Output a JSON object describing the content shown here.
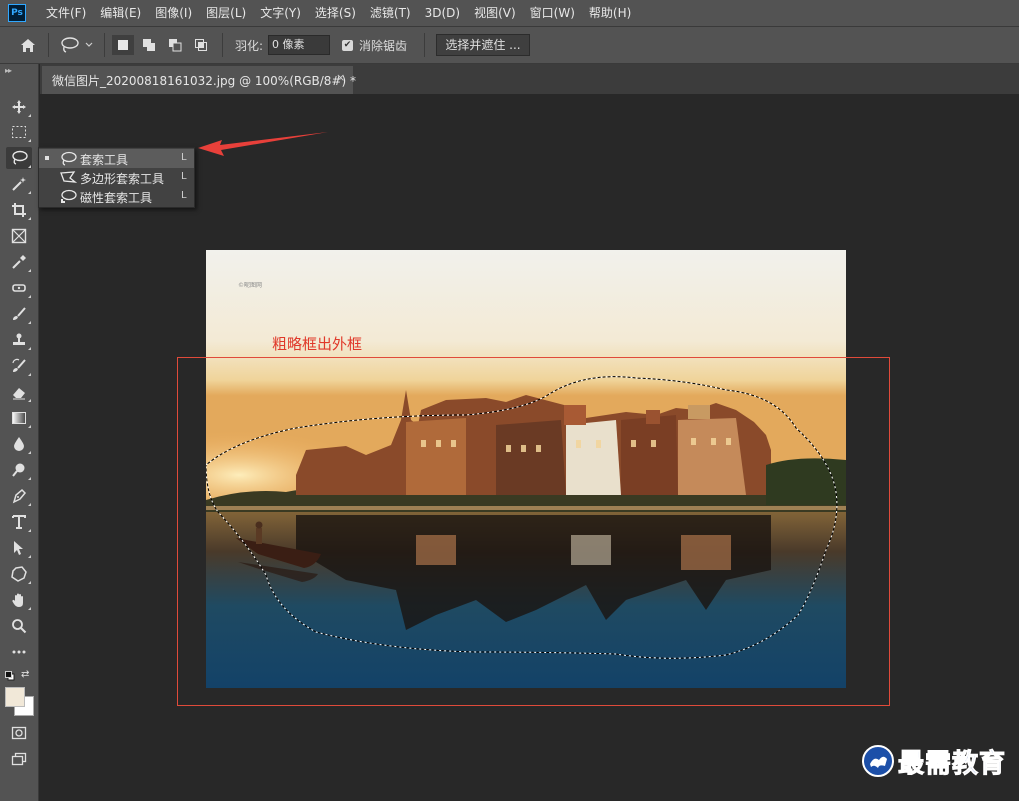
{
  "app": {
    "logo": "Ps",
    "accent": "#31a8ff"
  },
  "menubar": {
    "items": [
      "文件(F)",
      "编辑(E)",
      "图像(I)",
      "图层(L)",
      "文字(Y)",
      "选择(S)",
      "滤镜(T)",
      "3D(D)",
      "视图(V)",
      "窗口(W)",
      "帮助(H)"
    ]
  },
  "options_bar": {
    "home_icon": "home-icon",
    "tool_icon": "lasso-icon",
    "selection_modes": [
      "new-selection-icon",
      "add-to-selection-icon",
      "subtract-from-selection-icon",
      "intersect-selection-icon"
    ],
    "feather_label": "羽化:",
    "feather_value": "0 像素",
    "antialias_checked": true,
    "antialias_label": "消除锯齿",
    "select_mask_label": "选择并遮住 ..."
  },
  "document_tab": {
    "title": "微信图片_20200818161032.jpg @ 100%(RGB/8#) *",
    "close": "×"
  },
  "toolbox": {
    "tools": [
      "move-icon",
      "marquee-icon",
      "lasso-icon",
      "magic-wand-icon",
      "crop-icon",
      "frame-icon",
      "eyedropper-icon",
      "healing-icon",
      "brush-icon",
      "stamp-icon",
      "history-brush-icon",
      "eraser-icon",
      "gradient-icon",
      "blur-icon",
      "dodge-icon",
      "pen-icon",
      "type-icon",
      "path-select-icon",
      "shape-icon",
      "hand-icon",
      "zoom-icon",
      "more-icon"
    ],
    "foreground_color": "#f1e8d8",
    "background_color": "#ffffff"
  },
  "flyout": {
    "items": [
      {
        "label": "套索工具",
        "key": "L",
        "selected": true
      },
      {
        "label": "多边形套索工具",
        "key": "L",
        "selected": false
      },
      {
        "label": "磁性套索工具",
        "key": "L",
        "selected": false
      }
    ]
  },
  "canvas": {
    "annotation_text": "粗略框出外框",
    "annotation_color": "#e0392a"
  },
  "watermark": {
    "text": "最需教育",
    "color": "#2355b8"
  }
}
